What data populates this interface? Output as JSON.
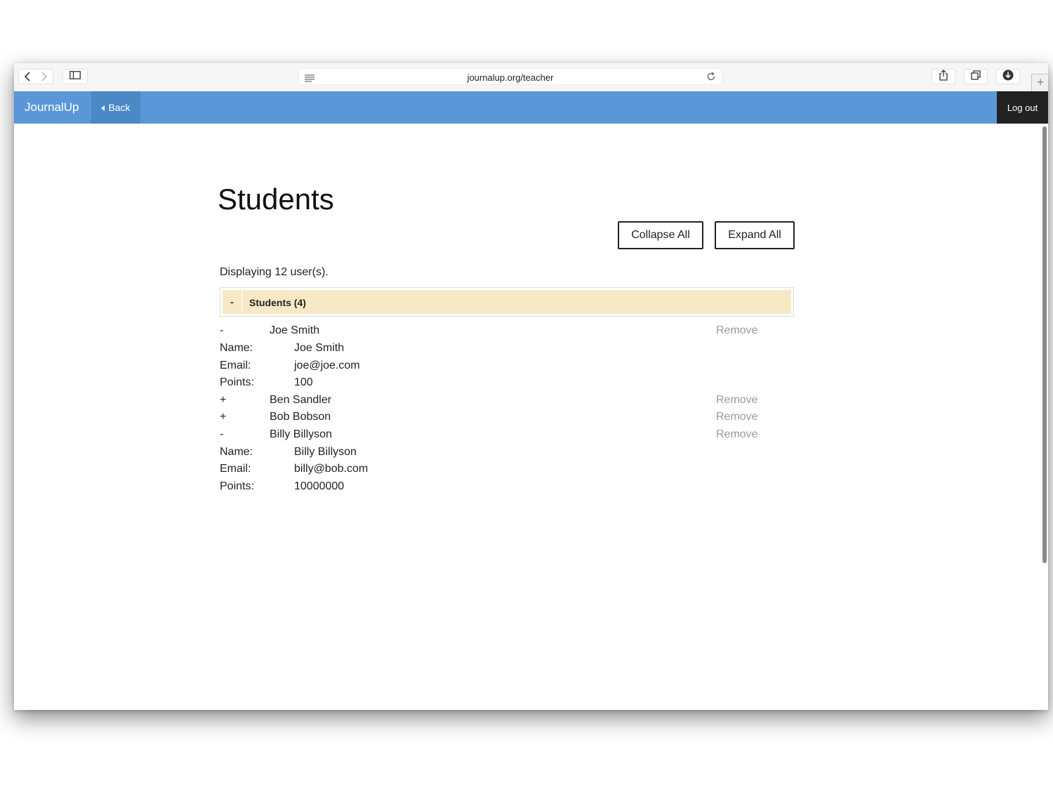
{
  "browser": {
    "url": "journalup.org/teacher",
    "new_tab_symbol": "+"
  },
  "navbar": {
    "brand": "JournalUp",
    "back_label": "Back",
    "logout_label": "Log out",
    "color": "#5b97d8"
  },
  "page": {
    "title": "Students",
    "collapse_all_label": "Collapse All",
    "expand_all_label": "Expand All",
    "display_count": "Displaying 12 user(s)."
  },
  "group": {
    "toggle": "-",
    "label": "Students (4)",
    "color": "#f8e9c6"
  },
  "labels": {
    "name": "Name:",
    "email": "Email:",
    "points": "Points:",
    "remove": "Remove"
  },
  "students": [
    {
      "toggle": "-",
      "name": "Joe Smith",
      "details": {
        "name": "Joe Smith",
        "email": "joe@joe.com",
        "points": "100"
      }
    },
    {
      "toggle": "+",
      "name": "Ben Sandler"
    },
    {
      "toggle": "+",
      "name": "Bob Bobson"
    },
    {
      "toggle": "-",
      "name": "Billy Billyson",
      "details": {
        "name": "Billy Billyson",
        "email": "billy@bob.com",
        "points": "10000000"
      }
    }
  ]
}
